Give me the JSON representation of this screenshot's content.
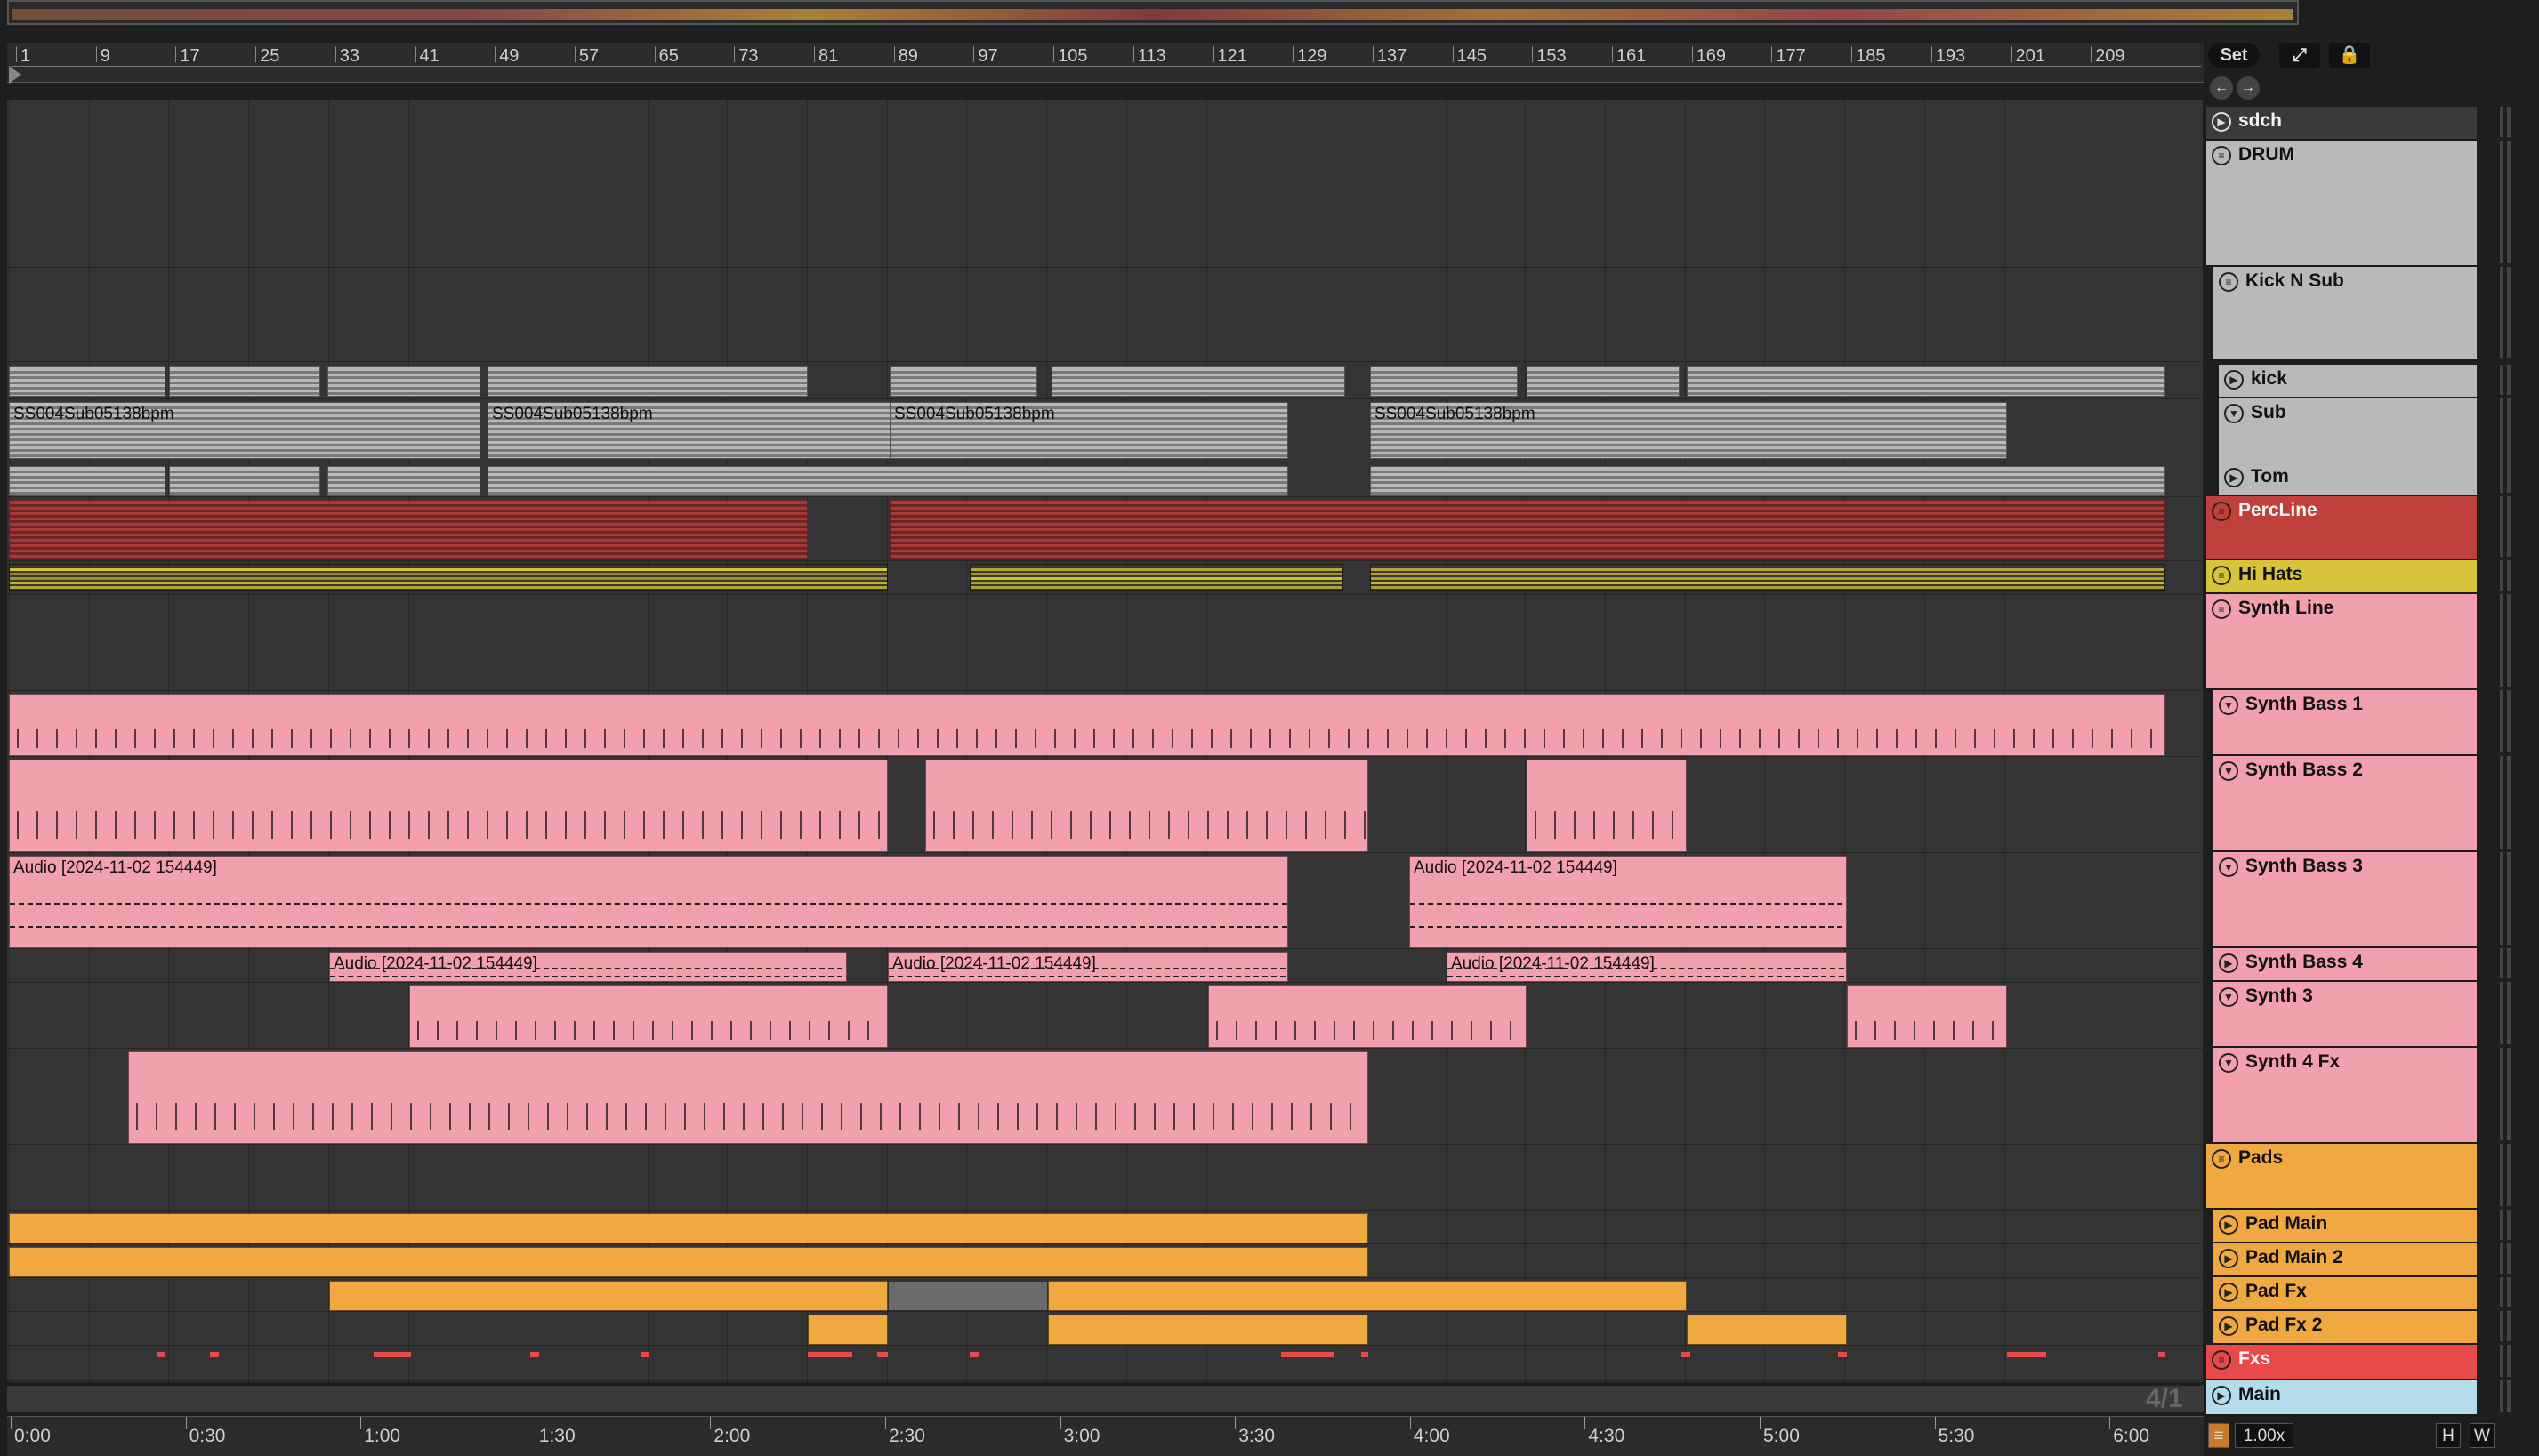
{
  "ruler": {
    "bars": [
      "1",
      "9",
      "17",
      "25",
      "33",
      "41",
      "49",
      "57",
      "65",
      "73",
      "81",
      "89",
      "97",
      "105",
      "113",
      "121",
      "129",
      "137",
      "145",
      "153",
      "161",
      "169",
      "177",
      "185",
      "193",
      "201",
      "209"
    ]
  },
  "timeline": {
    "labels": [
      "0:00",
      "0:30",
      "1:00",
      "1:30",
      "2:00",
      "2:30",
      "3:00",
      "3:30",
      "4:00",
      "4:30",
      "5:00",
      "5:30",
      "6:00"
    ]
  },
  "top_buttons": {
    "set": "Set"
  },
  "signature": "4/1",
  "zoom": "1.00x",
  "footer": {
    "h": "H",
    "w": "W"
  },
  "clip_names": {
    "sub": "SS004Sub05138bpm",
    "audio": "Audio [2024-11-02 154449]"
  },
  "tracks": [
    {
      "name": "sdch",
      "color": "#3a3a3a",
      "icon": "play-icon"
    },
    {
      "name": "DRUM",
      "color": "#b9b9b9",
      "icon": "group-icon"
    },
    {
      "name": "Kick N Sub",
      "color": "#b9b9b9",
      "icon": "group-icon"
    },
    {
      "name": "kick",
      "color": "#b9b9b9",
      "icon": "play-icon"
    },
    {
      "name": "Sub",
      "color": "#b9b9b9",
      "icon": "down-icon"
    },
    {
      "name": "Tom",
      "color": "#b9b9b9",
      "icon": "play-icon"
    },
    {
      "name": "PercLine",
      "color": "#c0403c",
      "icon": "group-icon"
    },
    {
      "name": "Hi Hats",
      "color": "#d8c43a",
      "icon": "group-icon"
    },
    {
      "name": "Synth Line",
      "color": "#f2a0ae",
      "icon": "group-icon"
    },
    {
      "name": "Synth Bass 1",
      "color": "#f2a0ae",
      "icon": "down-icon"
    },
    {
      "name": "Synth Bass 2",
      "color": "#f2a0ae",
      "icon": "down-icon"
    },
    {
      "name": "Synth Bass 3",
      "color": "#f2a0ae",
      "icon": "down-icon"
    },
    {
      "name": "Synth Bass 4",
      "color": "#f2a0ae",
      "icon": "play-icon"
    },
    {
      "name": "Synth 3",
      "color": "#f2a0ae",
      "icon": "down-icon"
    },
    {
      "name": "Synth 4 Fx",
      "color": "#f2a0ae",
      "icon": "down-icon"
    },
    {
      "name": "Pads",
      "color": "#f0a840",
      "icon": "group-icon"
    },
    {
      "name": "Pad Main",
      "color": "#f0a840",
      "icon": "play-icon"
    },
    {
      "name": "Pad Main 2",
      "color": "#f0a840",
      "icon": "play-icon"
    },
    {
      "name": "Pad Fx",
      "color": "#f0a840",
      "icon": "play-icon"
    },
    {
      "name": "Pad Fx 2",
      "color": "#f0a840",
      "icon": "play-icon"
    },
    {
      "name": "Fxs",
      "color": "#e84a4a",
      "icon": "group-icon"
    },
    {
      "name": "Main",
      "color": "#b5dcea",
      "icon": "play-icon"
    }
  ]
}
